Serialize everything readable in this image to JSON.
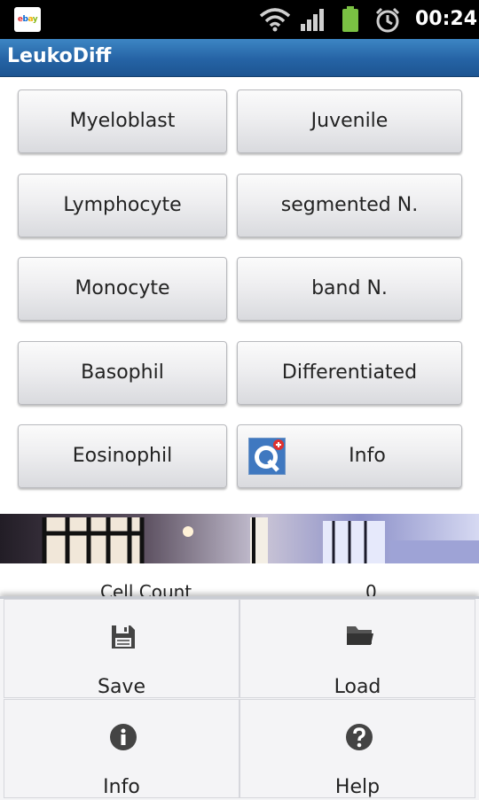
{
  "status_bar": {
    "time": "00:24",
    "icons": [
      "ebay-icon",
      "wifi-icon",
      "signal-icon",
      "battery-icon",
      "alarm-icon"
    ]
  },
  "app": {
    "title": "LeukoDiff"
  },
  "cell_buttons": {
    "myeloblast": "Myeloblast",
    "juvenile": "Juvenile",
    "lymphocyte": "Lymphocyte",
    "segmented": "segmented N.",
    "monocyte": "Monocyte",
    "band": "band N.",
    "basophil": "Basophil",
    "differentiated": "Differentiated",
    "eosinophil": "Eosinophil",
    "info": "Info"
  },
  "cell_count": {
    "label": "Cell Count",
    "value": "0"
  },
  "menu": {
    "save": "Save",
    "load": "Load",
    "info": "Info",
    "help": "Help"
  },
  "colors": {
    "title_bar": "#2563a5",
    "status_bar": "#000000",
    "battery": "#7ac143"
  }
}
